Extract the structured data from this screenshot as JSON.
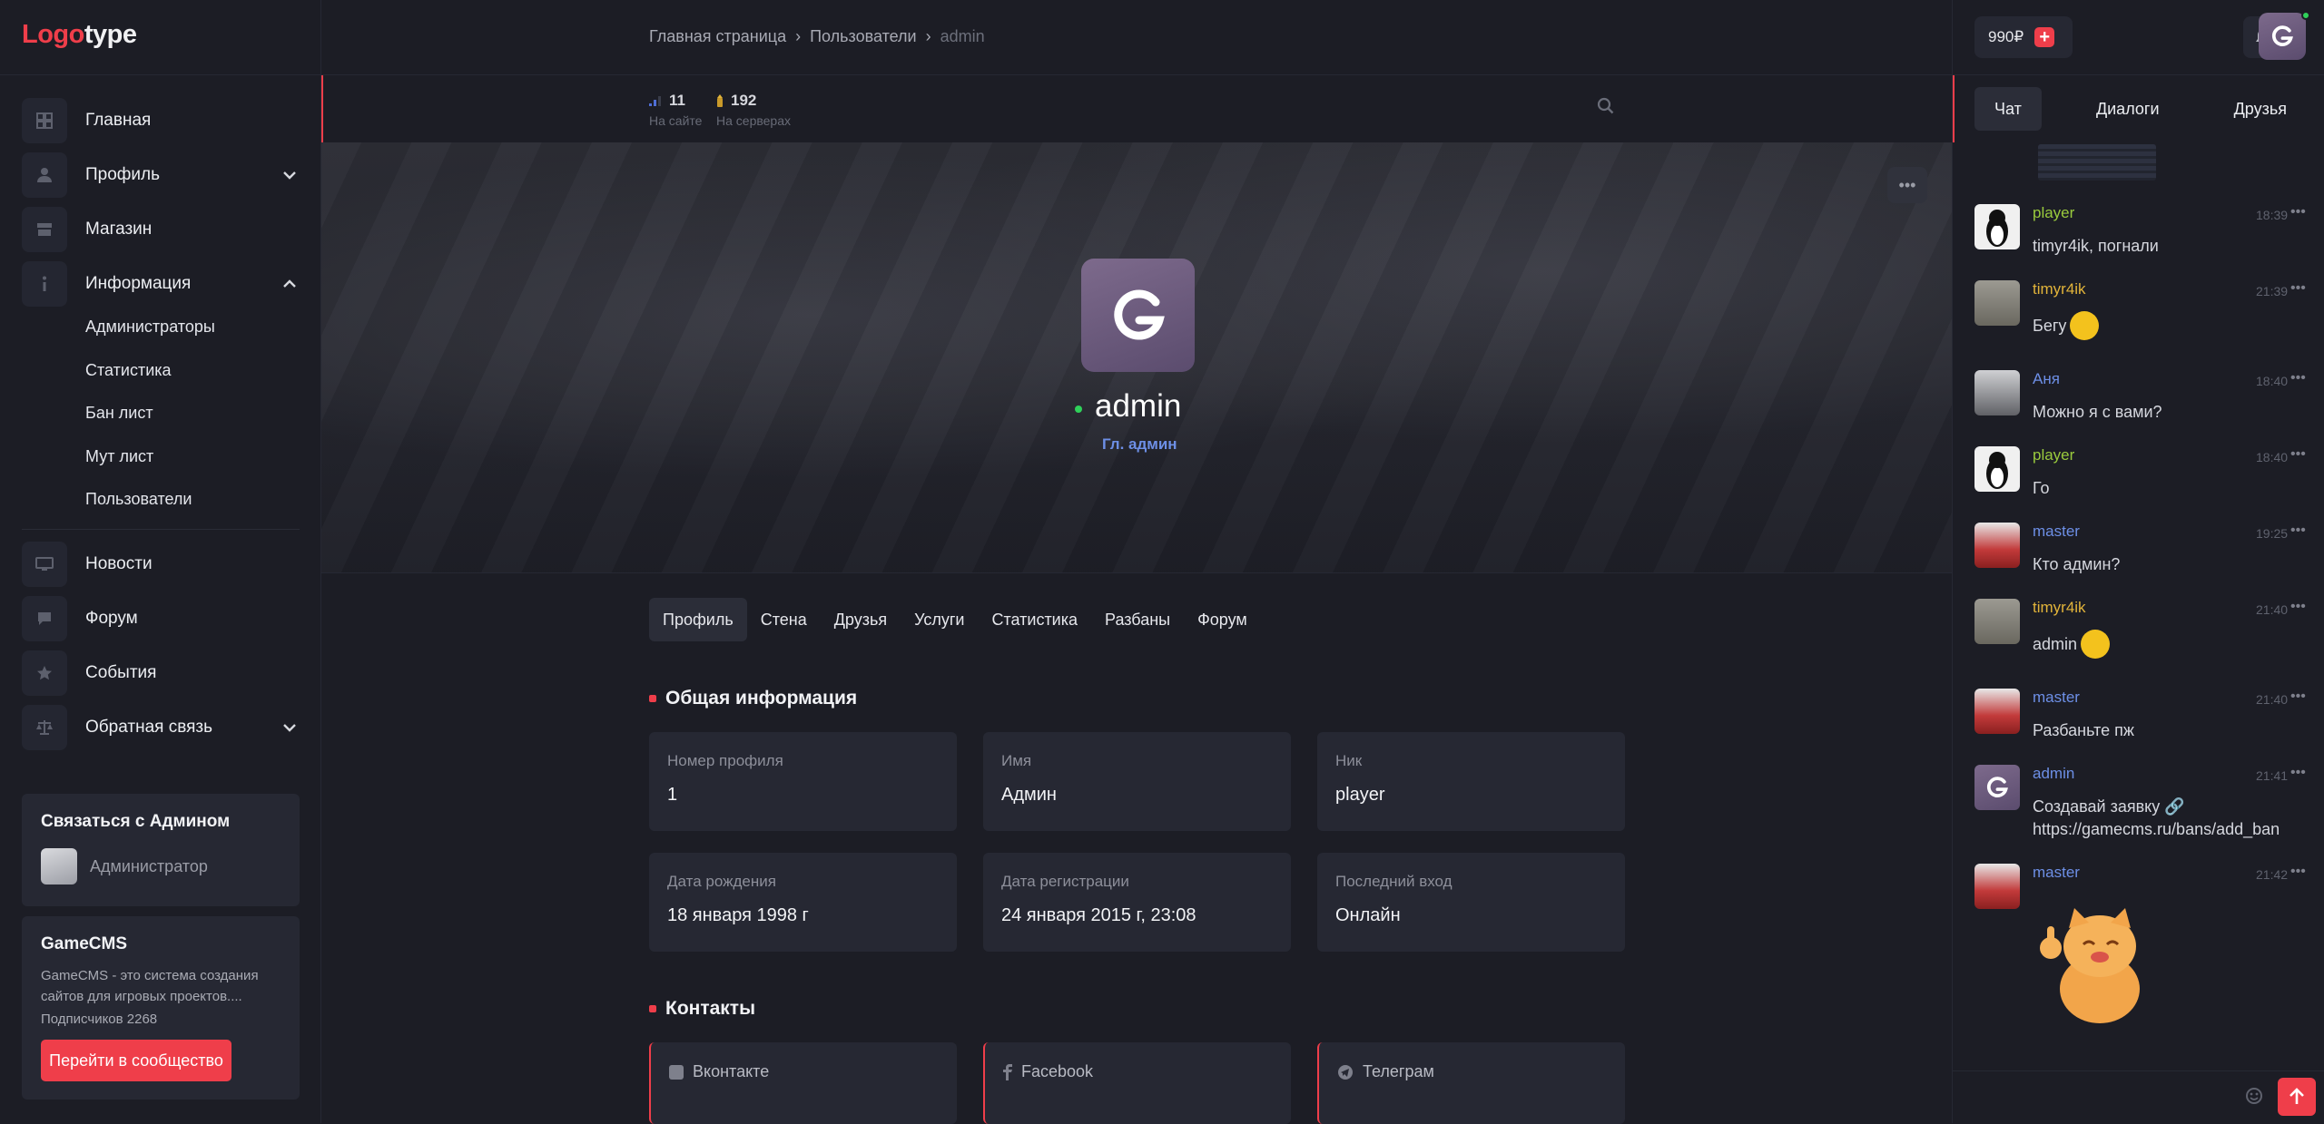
{
  "logo": {
    "part1": "Logo",
    "part2": "type"
  },
  "sidebar": {
    "items": [
      {
        "label": "Главная",
        "icon": "grid-icon"
      },
      {
        "label": "Профиль",
        "icon": "user-icon"
      },
      {
        "label": "Магазин",
        "icon": "store-icon"
      },
      {
        "label": "Информация",
        "icon": "info-icon"
      },
      {
        "label": "Новости",
        "icon": "monitor-icon"
      },
      {
        "label": "Форум",
        "icon": "chat-bubble-icon"
      },
      {
        "label": "События",
        "icon": "star-icon"
      },
      {
        "label": "Обратная связь",
        "icon": "scales-icon"
      }
    ],
    "subitems": [
      "Администраторы",
      "Статистика",
      "Бан лист",
      "Мут лист",
      "Пользователи"
    ],
    "contact_card": {
      "title": "Связаться с Админом",
      "role": "Администратор"
    },
    "community_card": {
      "title": "GameCMS",
      "description_line1": "GameCMS - это система создания",
      "description_line2": "сайтов для игровых проектов....",
      "subscribers": "Подписчиков 2268",
      "button": "Перейти в сообщество"
    }
  },
  "breadcrumbs": {
    "home": "Главная страница",
    "users": "Пользователи",
    "current": "admin",
    "sep": "›"
  },
  "stats": {
    "online": {
      "value": "11",
      "label": "На сайте"
    },
    "servers": {
      "value": "192",
      "label": "На серверах"
    }
  },
  "profile": {
    "username": "admin",
    "role": "Гл. админ",
    "tabs": [
      "Профиль",
      "Стена",
      "Друзья",
      "Услуги",
      "Статистика",
      "Разбаны",
      "Форум"
    ],
    "active_tab": "Профиль",
    "general_title": "Общая информация",
    "fields": [
      {
        "label": "Номер профиля",
        "value": "1"
      },
      {
        "label": "Имя",
        "value": "Админ"
      },
      {
        "label": "Ник",
        "value": "player"
      },
      {
        "label": "Дата рождения",
        "value": "18 января 1998 г"
      },
      {
        "label": "Дата регистрации",
        "value": "24 января 2015 г, 23:08"
      },
      {
        "label": "Последний вход",
        "value": "Онлайн"
      }
    ],
    "contacts_title": "Контакты",
    "contacts": [
      {
        "label": "Вконтакте",
        "icon": "vk-icon"
      },
      {
        "label": "Facebook",
        "icon": "facebook-icon"
      },
      {
        "label": "Телеграм",
        "icon": "telegram-icon"
      }
    ]
  },
  "topbar": {
    "balance": "990₽"
  },
  "chat": {
    "tabs": [
      "Чат",
      "Диалоги",
      "Друзья"
    ],
    "active_tab": "Чат",
    "messages": [
      {
        "author": "player",
        "time": "18:39",
        "text": "timyr4ik, погнали",
        "color": "#9acb3d"
      },
      {
        "author": "timyr4ik",
        "time": "21:39",
        "text": "Бегу",
        "color": "#e2b43a"
      },
      {
        "author": "Аня",
        "time": "18:40",
        "text": "Можно я с вами?",
        "color": "#6d8fe6"
      },
      {
        "author": "player",
        "time": "18:40",
        "text": "Го",
        "color": "#9acb3d"
      },
      {
        "author": "master",
        "time": "19:25",
        "text": "Кто админ?",
        "color": "#6d8fe6"
      },
      {
        "author": "timyr4ik",
        "time": "21:40",
        "text": "admin",
        "color": "#e2b43a"
      },
      {
        "author": "master",
        "time": "21:40",
        "text": "Разбаньте пж",
        "color": "#6d8fe6"
      },
      {
        "author": "admin",
        "time": "21:41",
        "text": "Создавай заявку 🔗 https://gamecms.ru/bans/add_ban",
        "color": "#6d8fe6"
      },
      {
        "author": "master",
        "time": "21:42",
        "text": "",
        "color": "#6d8fe6"
      }
    ]
  },
  "colors": {
    "accent": "#ef3e4a",
    "online": "#2fd15a",
    "bg": "#1c1d25",
    "card": "#262833"
  }
}
